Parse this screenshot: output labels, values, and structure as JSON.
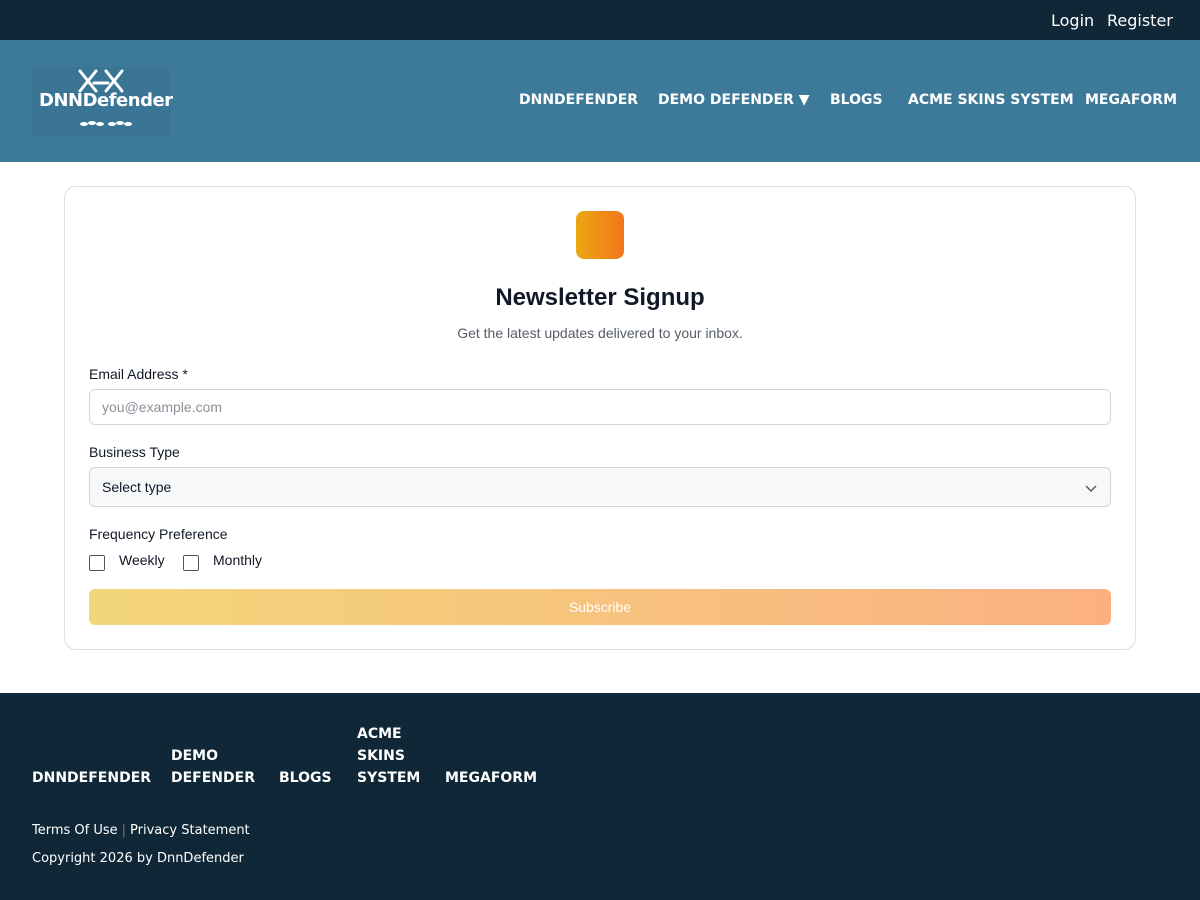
{
  "topbar": {
    "login": "Login",
    "register": "Register"
  },
  "header": {
    "logo_text": "DNNDefender",
    "nav": [
      "DNNDEFENDER",
      "DEMO DEFENDER ▼",
      "BLOGS",
      "ACME SKINS SYSTEM",
      "MEGAFORM"
    ]
  },
  "form": {
    "title": "Newsletter Signup",
    "subtitle": "Get the latest updates delivered to your inbox.",
    "email_label": "Email Address *",
    "email_placeholder": "you@example.com",
    "email_value": "",
    "business_label": "Business Type",
    "business_selected": "Select type",
    "frequency_label": "Frequency Preference",
    "options": [
      {
        "label": "Weekly",
        "checked": false
      },
      {
        "label": "Monthly",
        "checked": false
      }
    ],
    "submit_label": "Subscribe"
  },
  "footer": {
    "nav": [
      "DNNDEFENDER",
      "DEMO DEFENDER",
      "BLOGS",
      "ACME SKINS SYSTEM",
      "MEGAFORM"
    ],
    "terms": "Terms Of Use",
    "separator": "|",
    "privacy": "Privacy Statement",
    "copyright": "Copyright 2026 by DnnDefender"
  },
  "colors": {
    "topbar_bg": "#0f2736",
    "header_bg": "#3d7a9a",
    "badge_gradient_start": "#eaa812",
    "badge_gradient_end": "#f2761b",
    "button_gradient_start": "#f3d67a",
    "button_gradient_end": "#fbb082"
  }
}
